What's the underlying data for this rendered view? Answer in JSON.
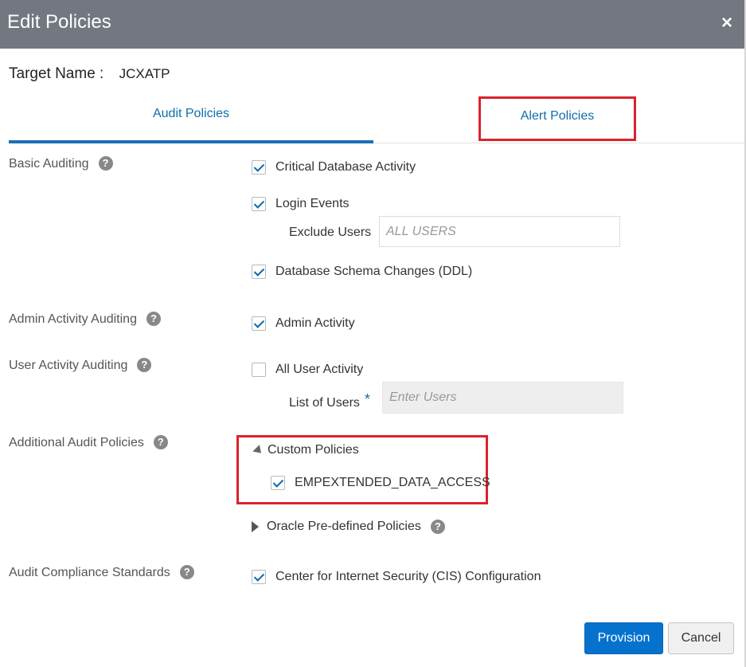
{
  "dialog": {
    "title": "Edit Policies",
    "close_glyph": "×"
  },
  "target": {
    "label": "Target Name :",
    "value": "JCXATP"
  },
  "tabs": [
    {
      "label": "Audit Policies"
    },
    {
      "label": "Alert Policies"
    }
  ],
  "basic_auditing": {
    "label": "Basic Auditing",
    "options": [
      {
        "label": "Critical Database Activity",
        "checked": true
      },
      {
        "label": "Login Events",
        "checked": true
      },
      {
        "label": "Database Schema Changes (DDL)",
        "checked": true
      }
    ],
    "exclude_users": {
      "label": "Exclude Users",
      "placeholder": "ALL USERS"
    }
  },
  "admin_activity": {
    "label": "Admin Activity Auditing",
    "option": "Admin Activity",
    "checked": true
  },
  "user_activity": {
    "label": "User Activity Auditing",
    "option": "All User Activity",
    "checked": false,
    "list_users": {
      "label": "List of Users",
      "required_marker": "*",
      "placeholder": "Enter Users"
    }
  },
  "additional": {
    "label": "Additional Audit Policies",
    "custom_policies": {
      "label": "Custom Policies",
      "items": [
        {
          "label": "EMPEXTENDED_DATA_ACCESS",
          "checked": true
        }
      ]
    },
    "predefined": {
      "label": "Oracle Pre-defined Policies"
    }
  },
  "compliance": {
    "label": "Audit Compliance Standards",
    "option": "Center for Internet Security (CIS) Configuration",
    "checked": true
  },
  "help_glyph": "?",
  "buttons": {
    "provision": "Provision",
    "cancel": "Cancel"
  },
  "colors": {
    "titlebar": "#737880",
    "accent": "#0572ce",
    "highlight": "#d9232d",
    "check": "#0b6aa9"
  }
}
